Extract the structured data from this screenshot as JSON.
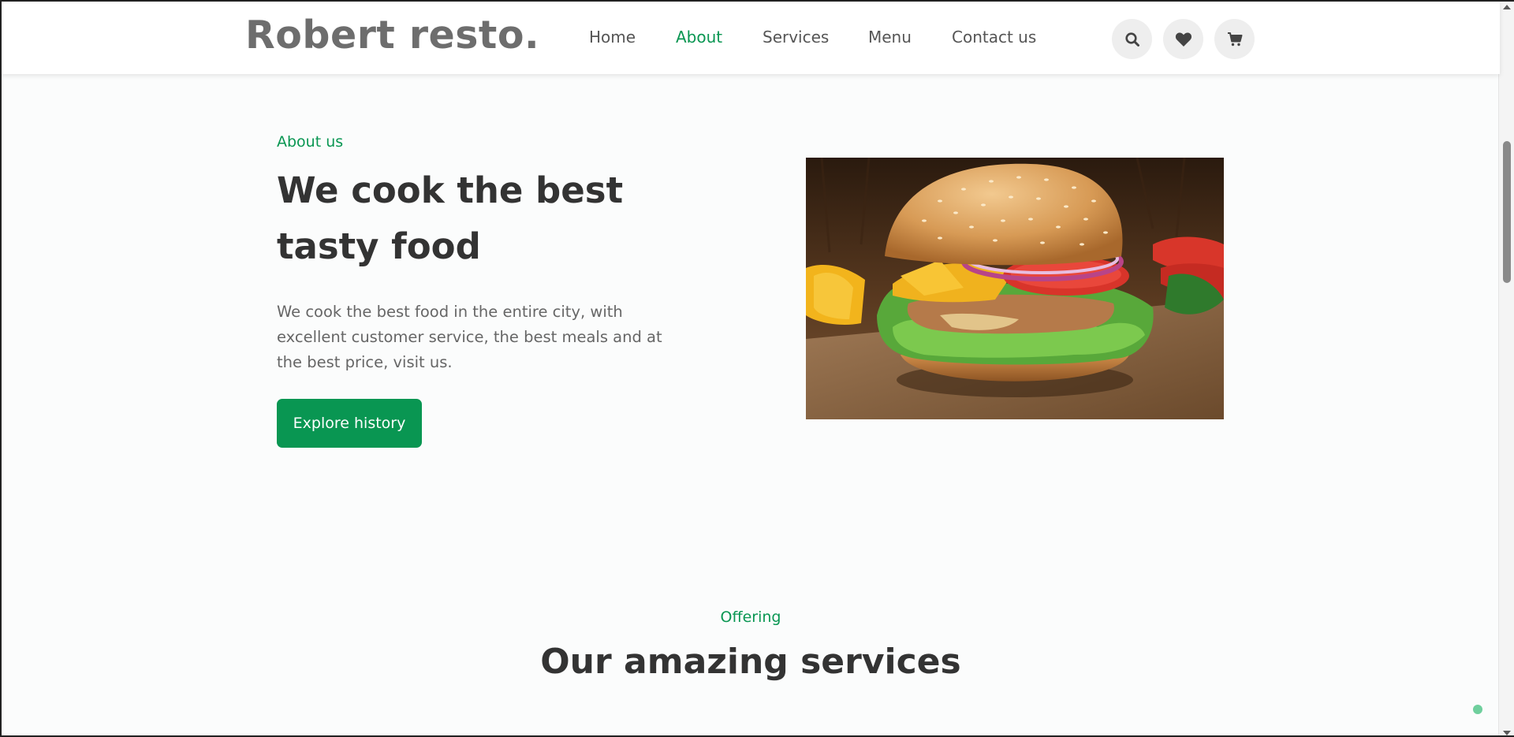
{
  "header": {
    "logo": "Robert resto.",
    "nav": [
      {
        "label": "Home"
      },
      {
        "label": "About",
        "active": true
      },
      {
        "label": "Services"
      },
      {
        "label": "Menu"
      },
      {
        "label": "Contact us"
      }
    ],
    "icons": [
      "search-icon",
      "heart-icon",
      "cart-icon"
    ]
  },
  "about": {
    "eyebrow": "About us",
    "heading": "We cook the best tasty food",
    "description": "We cook the best food in the entire city, with excellent customer service, the best meals and at the best price, visit us.",
    "button_label": "Explore history",
    "image": "burger-photo"
  },
  "services": {
    "eyebrow": "Offering",
    "heading": "Our amazing services"
  },
  "colors": {
    "accent": "#099652",
    "heading": "#333333",
    "body_text": "#666666",
    "logo": "#6d6d6d",
    "background": "#fbfcfc"
  }
}
